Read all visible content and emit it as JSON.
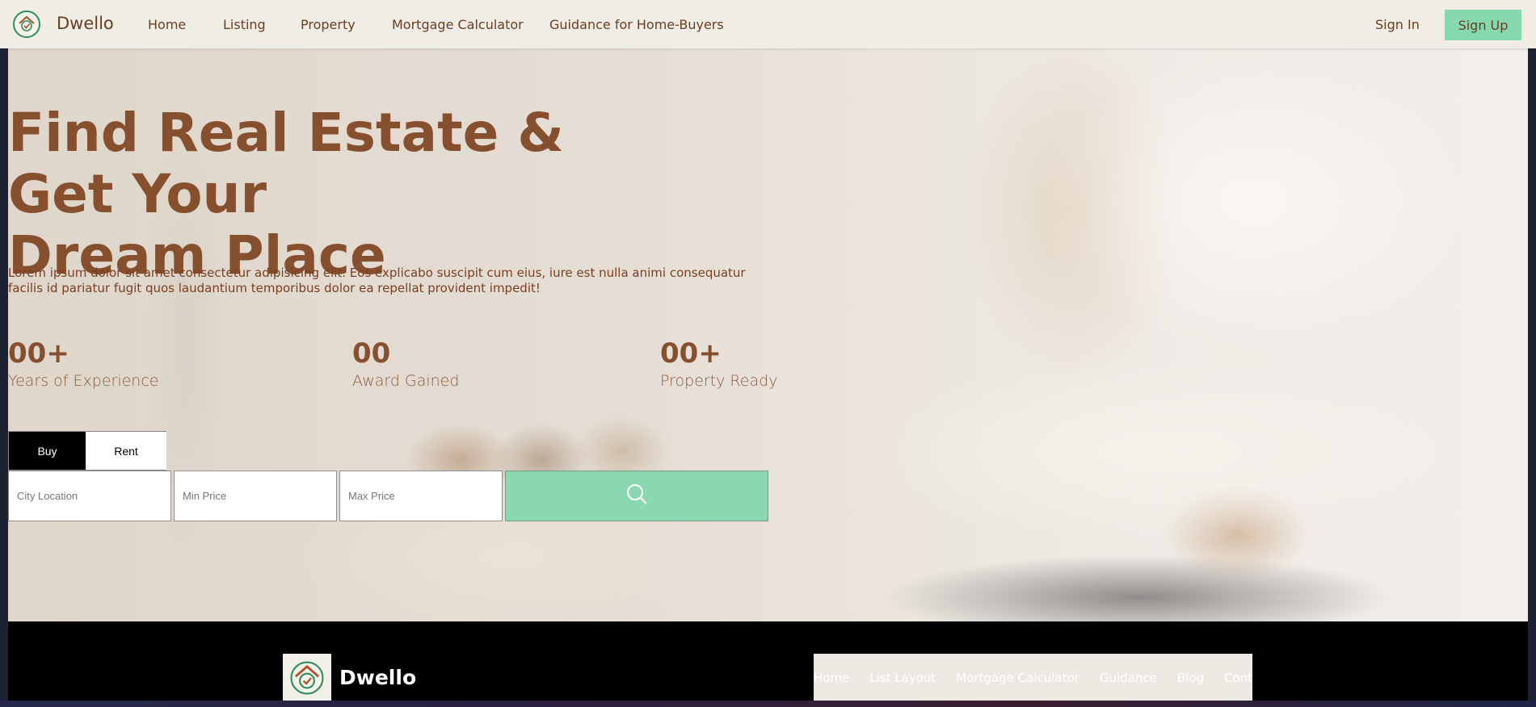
{
  "nav": {
    "brand": "Dwello",
    "links": [
      "Home",
      "Listing",
      "Property",
      "Mortgage Calculator",
      "Guidance for Home-Buyers"
    ],
    "sign_in": "Sign In",
    "sign_up": "Sign Up"
  },
  "hero": {
    "title_line1": "Find Real Estate & Get Your",
    "title_line2": "Dream Place",
    "description": "Lorem ipsum dolor sit amet consectetur adipisicing elit. Eos explicabo suscipit cum eius, iure est nulla animi consequatur facilis id pariatur fugit quos laudantium temporibus dolor ea repellat provident impedit!",
    "stats": [
      {
        "value": "00+",
        "label": "Years of Experience"
      },
      {
        "value": "00",
        "label": "Award Gained"
      },
      {
        "value": "00+",
        "label": "Property Ready"
      }
    ]
  },
  "search": {
    "tabs": [
      "Buy",
      "Rent"
    ],
    "active_tab": "Buy",
    "city_placeholder": "City Location",
    "min_placeholder": "Min Price",
    "max_placeholder": "Max Price",
    "icon": "search-icon"
  },
  "footer": {
    "brand": "Dwello",
    "links": [
      "Home",
      "List Layout",
      "Mortgage Calculator",
      "Guidance",
      "Blog",
      "Contact"
    ]
  },
  "colors": {
    "brand_brown": "#86502f",
    "accent_green": "#8ad7b0",
    "nav_bg": "#efede5"
  }
}
